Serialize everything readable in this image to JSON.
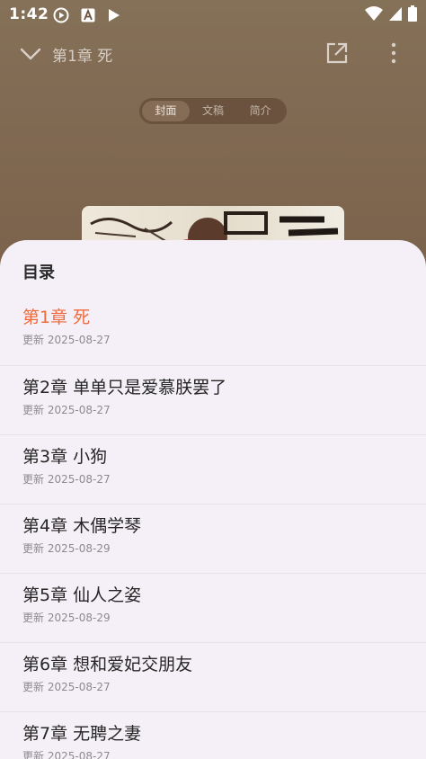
{
  "status_bar": {
    "time": "1:42"
  },
  "header": {
    "title": "第1章 死",
    "tabs": [
      {
        "label": "封面",
        "active": true
      },
      {
        "label": "文稿",
        "active": false
      },
      {
        "label": "简介",
        "active": false
      }
    ]
  },
  "toc": {
    "title": "目录",
    "update_prefix": "更新",
    "current_color": "#ef6a3c",
    "chapters": [
      {
        "title": "第1章 死",
        "date": "2025-08-27"
      },
      {
        "title": "第2章 单单只是爱慕朕罢了",
        "date": "2025-08-27"
      },
      {
        "title": "第3章 小狗",
        "date": "2025-08-27"
      },
      {
        "title": "第4章 木偶学琴",
        "date": "2025-08-29"
      },
      {
        "title": "第5章 仙人之姿",
        "date": "2025-08-29"
      },
      {
        "title": "第6章 想和爱妃交朋友",
        "date": "2025-08-27"
      },
      {
        "title": "第7章 无聘之妻",
        "date": "2025-08-27"
      }
    ]
  }
}
